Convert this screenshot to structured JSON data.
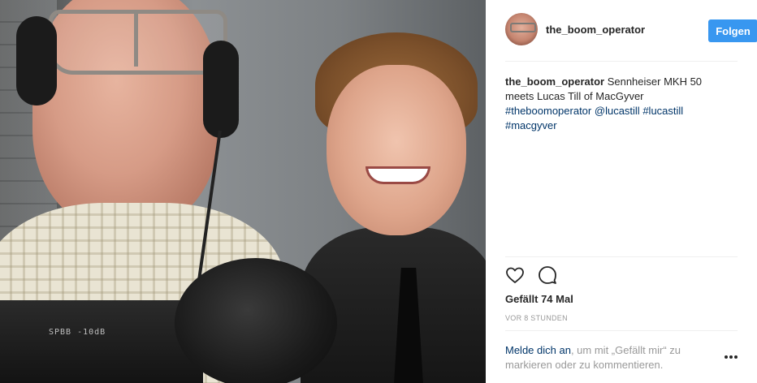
{
  "post": {
    "username": "the_boom_operator",
    "follow_label": "Folgen",
    "caption": {
      "username": "the_boom_operator",
      "text": " Sennheiser MKH 50 meets Lucas Till of MacGyver ",
      "hashtags": [
        "#theboomoperator",
        "@lucastill",
        "#lucastill",
        "#macgyver"
      ]
    },
    "likes_label": "Gefällt 74 Mal",
    "time_label": "VOR 8 STUNDEN",
    "login_prompt": {
      "link": "Melde dich an",
      "rest": ", um mit „Gefällt mir“ zu markieren oder zu kommentieren."
    },
    "camera_text": "SPBB -10dB"
  },
  "icons": {
    "like": "heart-icon",
    "comment": "comment-icon",
    "more": "more-options-icon"
  },
  "colors": {
    "follow_button": "#3897f0",
    "link": "#003569",
    "muted": "#999999"
  }
}
